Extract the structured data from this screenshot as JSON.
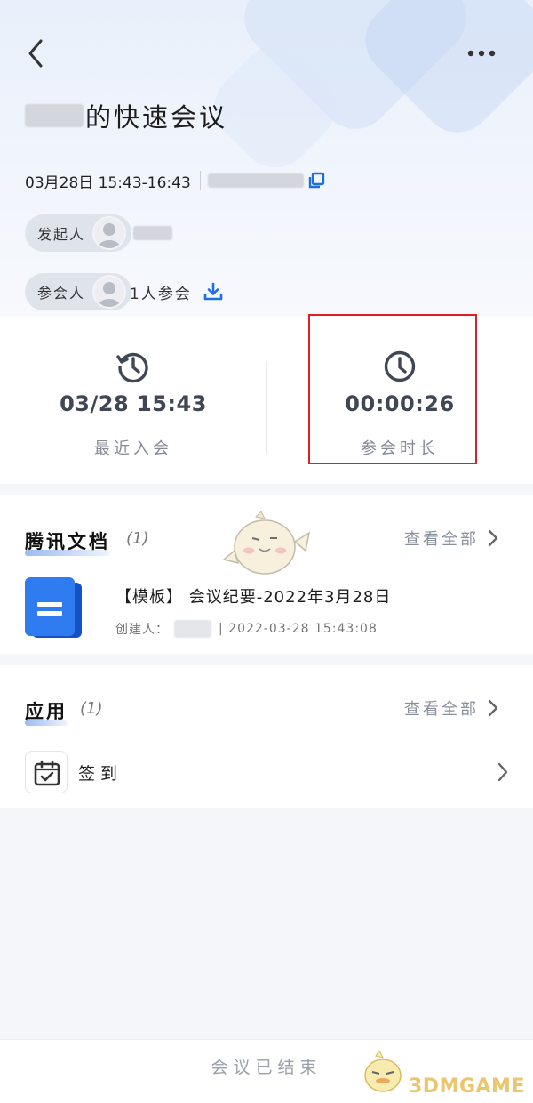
{
  "meeting": {
    "title_suffix": "的快速会议",
    "time": "03月28日 15:43-16:43"
  },
  "initiator": {
    "label": "发起人"
  },
  "participants": {
    "label": "参会人",
    "count_text": "1人参会"
  },
  "stats": {
    "recent_join": {
      "value": "03/28 15:43",
      "label": "最近入会"
    },
    "duration": {
      "value": "00:00:26",
      "label": "参会时长"
    }
  },
  "docs": {
    "title": "腾讯文档",
    "count": "(1)",
    "view_all": "查看全部",
    "items": [
      {
        "title": "【模板】 会议纪要-2022年3月28日",
        "creator_label": "创建人：",
        "created": "| 2022-03-28 15:43:08"
      }
    ]
  },
  "apps": {
    "title": "应用",
    "count": "(1)",
    "view_all": "查看全部",
    "items": [
      {
        "label": "签到"
      }
    ]
  },
  "footer": {
    "status": "会议已结束"
  },
  "watermark": {
    "text": "3DMGAME"
  },
  "colors": {
    "accent": "#1e6fe0",
    "highlight_box": "#e02020",
    "stat_text": "#404654"
  },
  "icons": [
    "back-arrow-icon",
    "more-icon",
    "copy-icon",
    "avatar-icon",
    "download-icon",
    "history-clock-icon",
    "clock-icon",
    "chevron-right-icon",
    "document-icon",
    "calendar-check-icon"
  ]
}
